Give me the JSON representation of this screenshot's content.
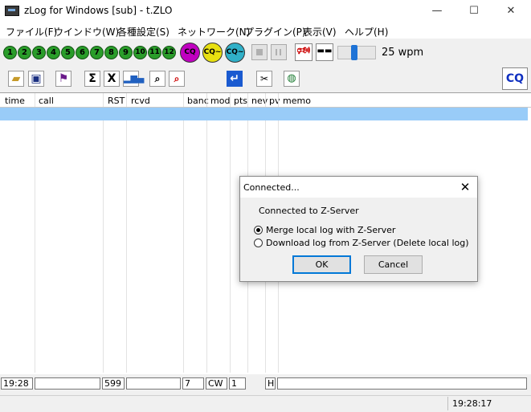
{
  "window": {
    "title": "zLog for Windows  [sub] - t.ZLO",
    "minimize_symbol": "—",
    "maximize_symbol": "☐",
    "close_symbol": "✕"
  },
  "menu": [
    "ファイル(F)",
    "ウインドウ(W)",
    "各種設定(S)",
    "ネットワーク(N)",
    "プラグイン(P)",
    "表示(V)",
    "ヘルプ(H)"
  ],
  "bands": [
    "1",
    "2",
    "3",
    "4",
    "5",
    "6",
    "7",
    "8",
    "9",
    "10",
    "11",
    "12"
  ],
  "cq_buttons": [
    {
      "label": "CQ",
      "color": "#c000c0"
    },
    {
      "label": "CQ~",
      "color": "#e8e010"
    },
    {
      "label": "CQ~",
      "color": "#30b0c8"
    }
  ],
  "speed": {
    "label": "25 wpm",
    "level_fraction": 0.4
  },
  "toolbar2": {
    "sigma": "Σ",
    "x": "X",
    "cq_label": "CQ"
  },
  "columns": [
    "time",
    "call",
    "RST",
    "rcvd",
    "banc",
    "mod",
    "pts",
    "nev",
    "pv",
    "memo"
  ],
  "entry": {
    "time": "19:28",
    "call": "",
    "rst": "599",
    "rcvd": "",
    "band": "7",
    "mode": "CW",
    "power": "1",
    "new": "",
    "pv": "H",
    "memo": ""
  },
  "status": {
    "time": "19:28:17"
  },
  "dialog": {
    "title": "Connected...",
    "close_symbol": "✕",
    "message": "Connected to Z-Server",
    "options": [
      {
        "label": "Merge local log with Z-Server",
        "selected": true
      },
      {
        "label": "Download log from Z-Server (Delete local log)",
        "selected": false
      }
    ],
    "ok_label": "OK",
    "cancel_label": "Cancel"
  },
  "colors": {
    "band_green": "#2a9d2a",
    "selection": "#99ccf8",
    "accent": "#0078d7",
    "cq_text": "#1030c0"
  }
}
